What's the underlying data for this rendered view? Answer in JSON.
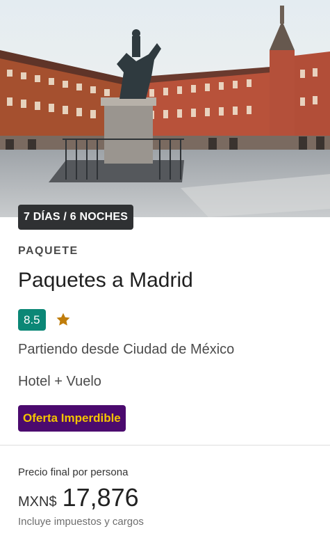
{
  "package": {
    "duration": "7 DÍAS / 6 NOCHES",
    "type": "PAQUETE",
    "title": "Paquetes a Madrid",
    "rating": "8.5",
    "origin": "Partiendo desde Ciudad de México",
    "composition": "Hotel + Vuelo",
    "promo": "Oferta Imperdible"
  },
  "price": {
    "caption": "Precio final por persona",
    "currency": "MXN$",
    "amount": "17,876",
    "note": "Incluye impuestos y cargos"
  },
  "colors": {
    "rating_badge": "#0b8776",
    "promo_background": "#4b0a6e",
    "promo_text": "#f4c400",
    "star": "#c07d0b"
  },
  "icons": [
    "star-icon"
  ]
}
